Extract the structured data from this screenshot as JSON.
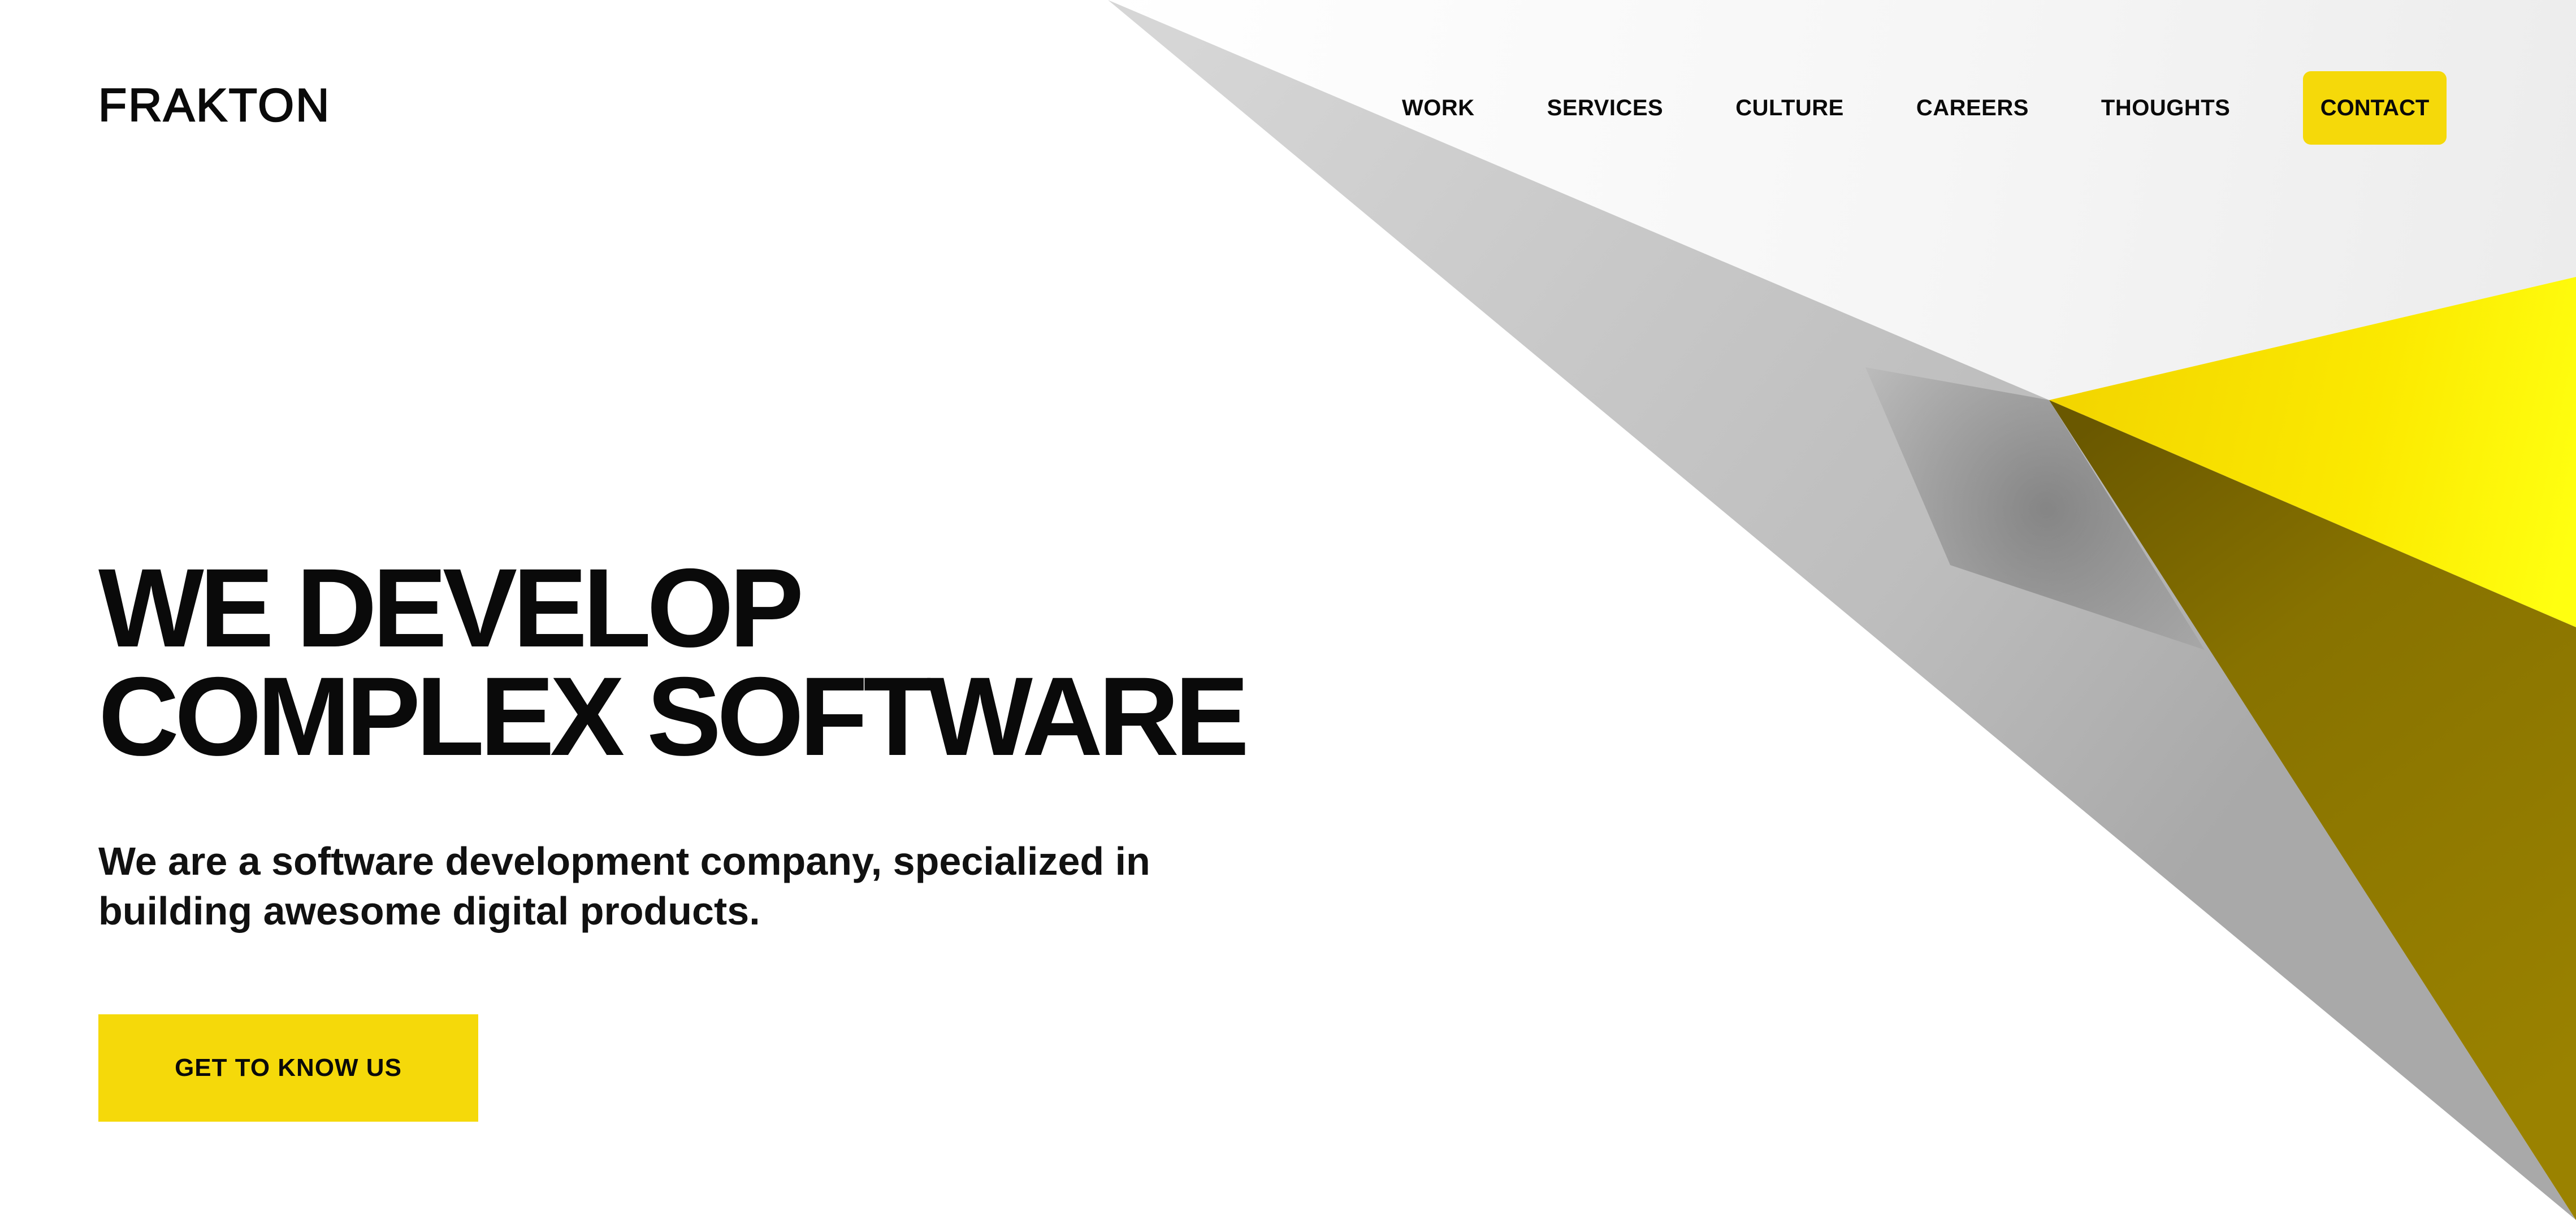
{
  "brand": {
    "logo_text": "FRAKTON"
  },
  "nav": {
    "items": [
      {
        "label": "WORK"
      },
      {
        "label": "SERVICES"
      },
      {
        "label": "CULTURE"
      },
      {
        "label": "CAREERS"
      },
      {
        "label": "THOUGHTS"
      }
    ],
    "contact_label": "CONTACT"
  },
  "hero": {
    "title_line_1": "WE DEVELOP",
    "title_line_2": "COMPLEX SOFTWARE",
    "subtitle_line_1": "We are a software development company, specialized in",
    "subtitle_line_2": "building awesome digital products.",
    "cta_label": "GET TO KNOW US"
  },
  "colors": {
    "accent_yellow": "#f5d90a",
    "text": "#0a0a0a",
    "background": "#ffffff"
  },
  "icons": [
    "folded-paper-shape-graphic"
  ]
}
